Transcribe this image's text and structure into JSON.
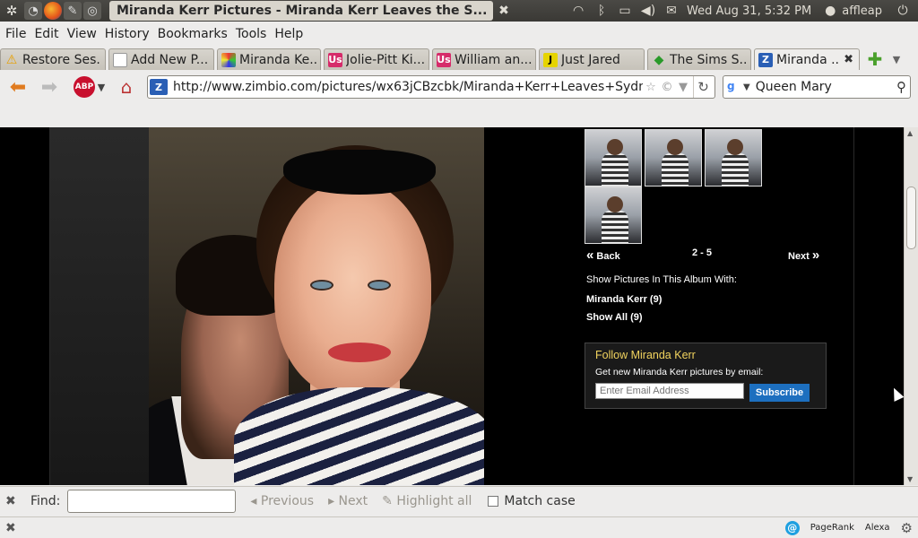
{
  "system_panel": {
    "window_title": "Miranda Kerr Pictures - Miranda Kerr Leaves the S...",
    "clock": "Wed Aug 31,  5:32 PM",
    "user": "affleap"
  },
  "menu": [
    "File",
    "Edit",
    "View",
    "History",
    "Bookmarks",
    "Tools",
    "Help"
  ],
  "tabs": [
    {
      "label": "Restore Ses...",
      "icon": "warning-icon",
      "color": "#e8a000"
    },
    {
      "label": "Add New P...",
      "icon": "page-icon",
      "color": "#777777"
    },
    {
      "label": "Miranda Ke...",
      "icon": "grid-icon",
      "color": "#444444"
    },
    {
      "label": "Jolie-Pitt Ki...",
      "icon": "us-icon",
      "color": "#d62b6a"
    },
    {
      "label": "William an...",
      "icon": "us-icon",
      "color": "#d62b6a"
    },
    {
      "label": "Just Jared",
      "icon": "jj-icon",
      "color": "#e6d400"
    },
    {
      "label": "The Sims S...",
      "icon": "plumbob-icon",
      "color": "#2a9a2a"
    },
    {
      "label": "Miranda ...",
      "icon": "zimbio-icon",
      "color": "#2a5fb5"
    }
  ],
  "toolbar": {
    "url": "http://www.zimbio.com/pictures/wx63jCBzcbk/Miranda+Kerr+Leaves+Sydney+A",
    "search_text": "Queen Mary",
    "abp_label": "ABP"
  },
  "page": {
    "pager": {
      "back": "Back",
      "range": "2 - 5",
      "next": "Next"
    },
    "show_heading": "Show Pictures In This Album With:",
    "filters": [
      "Miranda Kerr (9)",
      "Show All (9)"
    ],
    "follow": {
      "title": "Follow Miranda Kerr",
      "description": "Get new Miranda Kerr pictures by email:",
      "email_placeholder": "Enter Email Address",
      "subscribe_label": "Subscribe"
    }
  },
  "findbar": {
    "label": "Find:",
    "previous": "Previous",
    "next": "Next",
    "highlight": "Highlight all",
    "match_case": "Match case"
  },
  "statusbar": {
    "pagerank": "PageRank",
    "alexa": "Alexa"
  }
}
